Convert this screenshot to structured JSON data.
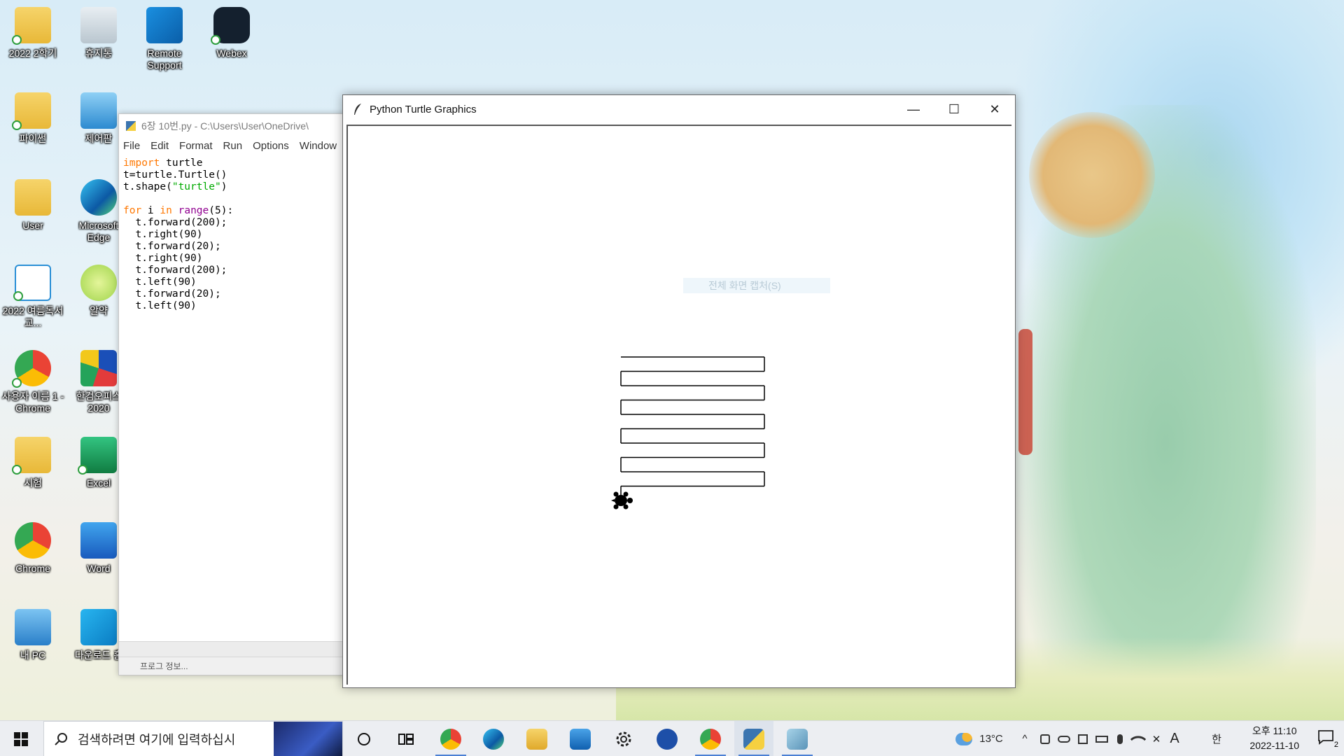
{
  "desktop": {
    "icons": [
      {
        "label": "2022 2학기",
        "name": "desktop-icon-2022-2nd-semester"
      },
      {
        "label": "휴지통",
        "name": "desktop-icon-recycle-bin"
      },
      {
        "label": "Remote Support",
        "name": "desktop-icon-remote-support"
      },
      {
        "label": "Webex",
        "name": "desktop-icon-webex"
      },
      {
        "label": "파이썬",
        "name": "desktop-icon-python-folder"
      },
      {
        "label": "제어판",
        "name": "desktop-icon-control-panel"
      },
      {
        "label": "User",
        "name": "desktop-icon-user"
      },
      {
        "label": "Microsoft Edge",
        "name": "desktop-icon-edge"
      },
      {
        "label": "2022 여름독서교...",
        "name": "desktop-icon-2022-reading"
      },
      {
        "label": "알약",
        "name": "desktop-icon-alyac"
      },
      {
        "label": "사용자 이름 1 - Chrome",
        "name": "desktop-icon-chrome-profile"
      },
      {
        "label": "한컴오피스 2020",
        "name": "desktop-icon-hancom-office"
      },
      {
        "label": "시험",
        "name": "desktop-icon-exam-folder"
      },
      {
        "label": "Excel",
        "name": "desktop-icon-excel"
      },
      {
        "label": "Chrome",
        "name": "desktop-icon-chrome"
      },
      {
        "label": "Word",
        "name": "desktop-icon-word"
      },
      {
        "label": "내 PC",
        "name": "desktop-icon-my-pc"
      },
      {
        "label": "다운로드 홈",
        "name": "desktop-icon-download-home"
      }
    ]
  },
  "idle": {
    "title": "6장 10번.py - C:\\Users\\User\\OneDrive\\",
    "menu": [
      "File",
      "Edit",
      "Format",
      "Run",
      "Options",
      "Window"
    ],
    "code_lines": [
      "import turtle",
      "t=turtle.Turtle()",
      "t.shape(\"turtle\")",
      "",
      "for i in range(5):",
      "  t.forward(200);",
      "  t.right(90)",
      "  t.forward(20);",
      "  t.right(90)",
      "  t.forward(200);",
      "  t.left(90)",
      "  t.forward(20);",
      "  t.left(90)"
    ],
    "status_text": "프로그 정보..."
  },
  "turtle_window": {
    "title": "Python Turtle Graphics",
    "ghost_text": "전체 화면 캡처(S)",
    "minimize_symbol": "—",
    "maximize_symbol": "☐",
    "close_symbol": "✕",
    "drawing": {
      "forward_long": 200,
      "forward_short": 20,
      "repeats": 5
    }
  },
  "taskbar": {
    "search_placeholder": "검색하려면 여기에 입력하십시",
    "weather_temp": "13°C",
    "ime_label": "한",
    "font_label": "A",
    "time": "오후 11:10",
    "date": "2022-11-10",
    "notification_count": "2",
    "colors": {
      "accent": "#4a7fd4"
    }
  }
}
